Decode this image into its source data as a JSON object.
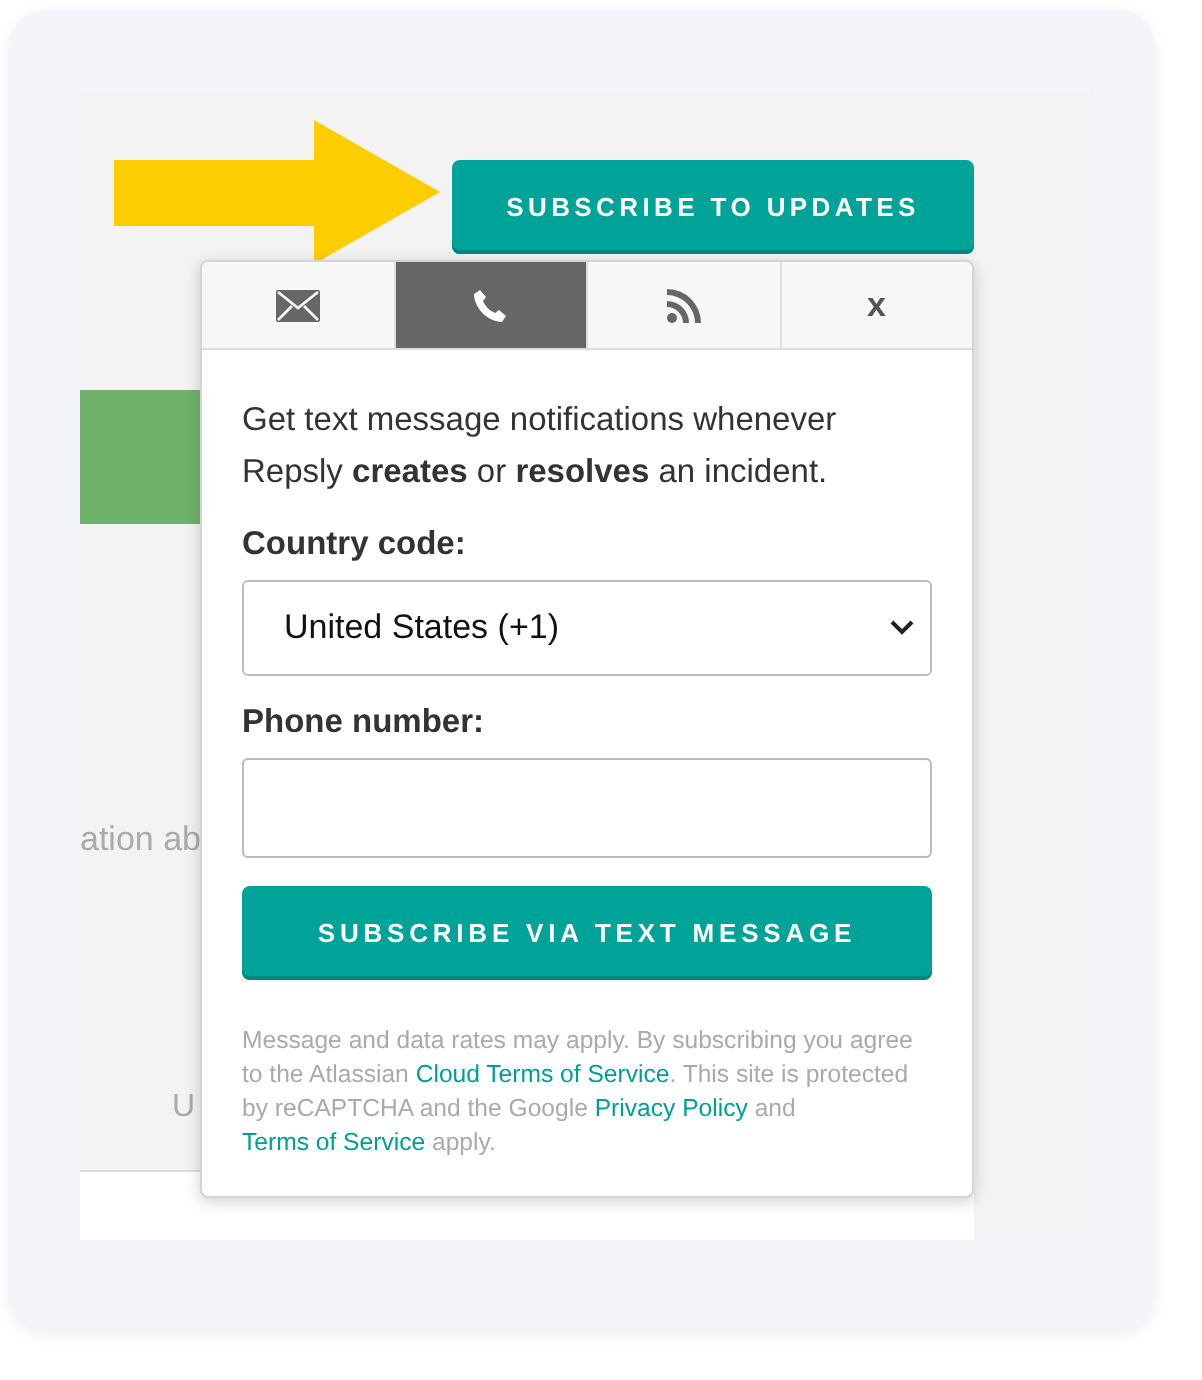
{
  "header_button": {
    "label": "SUBSCRIBE TO UPDATES"
  },
  "background": {
    "cut_text": "ation ab",
    "cut_letter": "U"
  },
  "popup": {
    "tabs": [
      {
        "kind": "email",
        "selected": false
      },
      {
        "kind": "sms",
        "selected": true
      },
      {
        "kind": "rss",
        "selected": false
      },
      {
        "kind": "text",
        "label": "x",
        "selected": false
      }
    ],
    "description": "Get text message notifications whenever Repsly **creates** or **resolves** an incident.",
    "country_label": "Country code:",
    "country_value": "United States (+1)",
    "phone_label": "Phone number:",
    "submit": "SUBSCRIBE VIA TEXT MESSAGE",
    "footer": [
      {
        "kind": "text",
        "text": "Message and data rates may apply. By subscribing you agree to the Atlassian "
      },
      {
        "kind": "link",
        "text": "Cloud Terms of Service"
      },
      {
        "kind": "text",
        "text": ". This site is protected by reCAPTCHA and the Google "
      },
      {
        "kind": "link",
        "text": "Privacy Policy"
      },
      {
        "kind": "text",
        "text": " and "
      },
      {
        "kind": "link",
        "text": "Terms of Service"
      },
      {
        "kind": "text",
        "text": " apply."
      }
    ]
  }
}
